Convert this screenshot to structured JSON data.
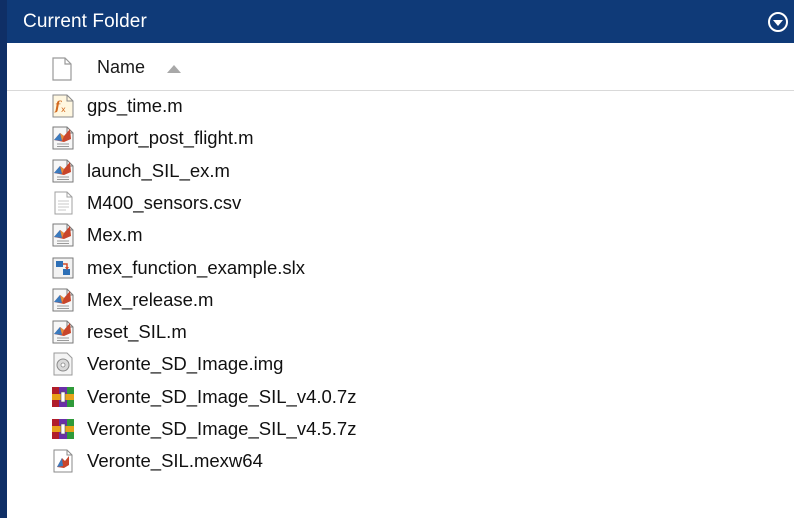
{
  "panel": {
    "title": "Current Folder",
    "menu_icon": "circle-chevron-down-icon"
  },
  "header": {
    "column_name": "Name",
    "sort_icon": "sort-ascending-icon"
  },
  "files": [
    {
      "name": "gps_time.m",
      "icon": "function-file-icon"
    },
    {
      "name": "import_post_flight.m",
      "icon": "matlab-script-icon"
    },
    {
      "name": "launch_SIL_ex.m",
      "icon": "matlab-script-icon"
    },
    {
      "name": "M400_sensors.csv",
      "icon": "text-file-icon"
    },
    {
      "name": "Mex.m",
      "icon": "matlab-script-icon"
    },
    {
      "name": "mex_function_example.slx",
      "icon": "simulink-model-icon"
    },
    {
      "name": "Mex_release.m",
      "icon": "matlab-script-icon"
    },
    {
      "name": "reset_SIL.m",
      "icon": "matlab-script-icon"
    },
    {
      "name": "Veronte_SD_Image.img",
      "icon": "disk-image-icon"
    },
    {
      "name": "Veronte_SD_Image_SIL_v4.0.7z",
      "icon": "archive-icon"
    },
    {
      "name": "Veronte_SD_Image_SIL_v4.5.7z",
      "icon": "archive-icon"
    },
    {
      "name": "Veronte_SIL.mexw64",
      "icon": "mex-file-icon"
    }
  ],
  "colors": {
    "title_bar": "#0f3a78",
    "title_text": "#ffffff"
  }
}
